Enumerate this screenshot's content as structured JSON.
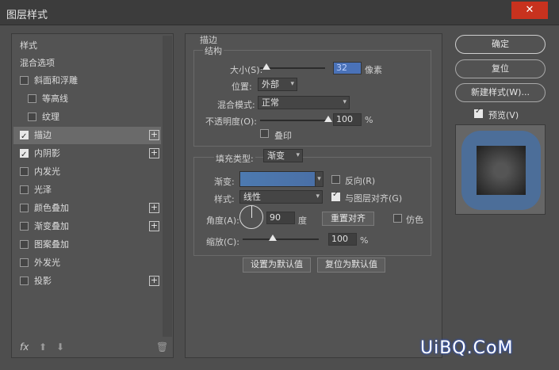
{
  "window": {
    "title": "图层样式",
    "close": "✕"
  },
  "sidebar": {
    "header": "样式",
    "items": [
      {
        "label": "混合选项",
        "checkbox": false,
        "checked": false,
        "plus": false
      },
      {
        "label": "斜面和浮雕",
        "checkbox": true,
        "checked": false,
        "plus": false
      },
      {
        "label": "等高线",
        "checkbox": true,
        "checked": false,
        "plus": false
      },
      {
        "label": "纹理",
        "checkbox": true,
        "checked": false,
        "plus": false
      },
      {
        "label": "描边",
        "checkbox": true,
        "checked": true,
        "plus": true
      },
      {
        "label": "内阴影",
        "checkbox": true,
        "checked": true,
        "plus": true
      },
      {
        "label": "内发光",
        "checkbox": true,
        "checked": false,
        "plus": false
      },
      {
        "label": "光泽",
        "checkbox": true,
        "checked": false,
        "plus": false
      },
      {
        "label": "颜色叠加",
        "checkbox": true,
        "checked": false,
        "plus": true
      },
      {
        "label": "渐变叠加",
        "checkbox": true,
        "checked": false,
        "plus": true
      },
      {
        "label": "图案叠加",
        "checkbox": true,
        "checked": false,
        "plus": false
      },
      {
        "label": "外发光",
        "checkbox": true,
        "checked": false,
        "plus": false
      },
      {
        "label": "投影",
        "checkbox": true,
        "checked": false,
        "plus": true
      }
    ],
    "footer": {
      "fx": "fx",
      "up": "⬆",
      "down": "⬇",
      "trash": "🗑"
    }
  },
  "stroke": {
    "title": "描边",
    "structure": "结构",
    "size_label": "大小(S):",
    "size_value": "32",
    "size_unit": "像素",
    "size_level": 0.1,
    "position_label": "位置:",
    "position_value": "外部",
    "blend_label": "混合模式:",
    "blend_value": "正常",
    "opacity_label": "不透明度(O):",
    "opacity_value": "100",
    "opacity_unit": "%",
    "opacity_level": 1.0,
    "overprint_label": "叠印",
    "fill_type_label": "填充类型:",
    "fill_type_value": "渐变",
    "gradient_label": "渐变:",
    "reverse_label": "反向(R)",
    "style_label": "样式:",
    "style_value": "线性",
    "align_label": "与图层对齐(G)",
    "angle_label": "角度(A):",
    "angle_value": "90",
    "angle_unit": "度",
    "reset_align": "重置对齐",
    "dither_label": "仿色",
    "scale_label": "缩放(C):",
    "scale_value": "100",
    "scale_unit": "%",
    "scale_level": 0.4,
    "make_default": "设置为默认值",
    "reset_default": "复位为默认值"
  },
  "actions": {
    "ok": "确定",
    "reset": "复位",
    "new_style": "新建样式(W)...",
    "preview": "预览(V)"
  },
  "watermark": "UiBQ.CoM",
  "colors": {
    "stroke_gradient": "#4d7ab0",
    "highlight": "#4a72b8",
    "close": "#c8321e"
  }
}
